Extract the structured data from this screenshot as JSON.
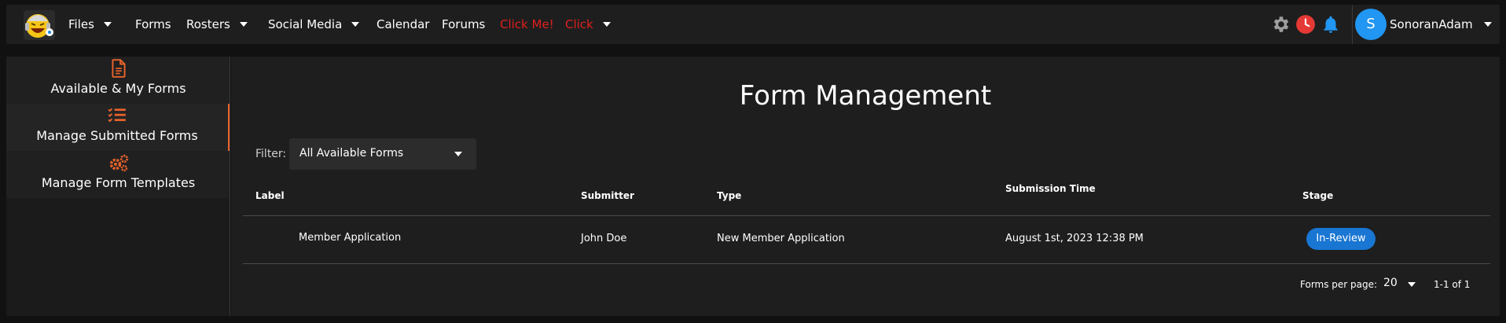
{
  "navbar": {
    "items": [
      {
        "label": "Files",
        "dropdown": true
      },
      {
        "label": "Forms",
        "dropdown": false
      },
      {
        "label": "Rosters",
        "dropdown": true
      },
      {
        "label": "Social Media",
        "dropdown": true
      },
      {
        "label": "Calendar",
        "dropdown": false
      },
      {
        "label": "Forums",
        "dropdown": false
      },
      {
        "label": "Click Me!",
        "dropdown": false,
        "color": "#e01e1e"
      },
      {
        "label": "Click",
        "dropdown": true,
        "color": "#e01e1e"
      }
    ],
    "icons": [
      "gear-icon",
      "clock-icon",
      "bell-icon"
    ],
    "user": {
      "initial": "S",
      "name": "SonoranAdam"
    }
  },
  "sidebar": {
    "items": [
      {
        "label": "Available & My Forms",
        "icon": "document-icon",
        "active": false
      },
      {
        "label": "Manage Submitted Forms",
        "icon": "checklist-icon",
        "active": true
      },
      {
        "label": "Manage Form Templates",
        "icon": "gears-icon",
        "active": false
      }
    ],
    "accent": "#e8632c"
  },
  "main": {
    "title": "Form Management",
    "filter": {
      "label": "Filter:",
      "value": "All Available Forms"
    },
    "table": {
      "headers": [
        "Label",
        "Submitter",
        "Type",
        "Submission Time",
        "Stage"
      ],
      "rows": [
        {
          "label": "Member Application",
          "submitter": "John Doe",
          "type": "New Member Application",
          "time": "August 1st, 2023 12:38 PM",
          "stage": "In-Review"
        }
      ]
    },
    "pagination": {
      "per_page_label": "Forms per page:",
      "per_page": "20",
      "range": "1-1 of 1"
    }
  }
}
